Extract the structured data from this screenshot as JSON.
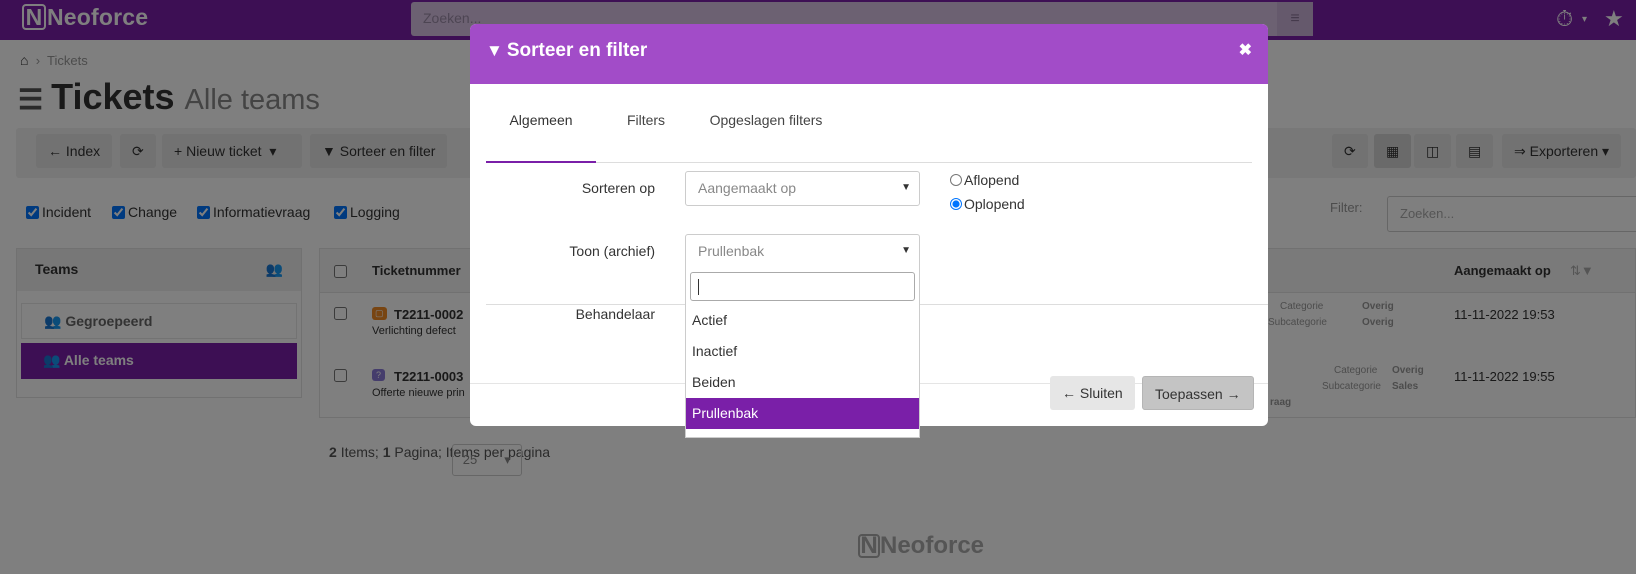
{
  "app": {
    "brand": "Neoforce",
    "search_placeholder": "Zoeken..."
  },
  "breadcrumb": {
    "current": "Tickets"
  },
  "page": {
    "title": "Tickets",
    "subtitle": "Alle teams"
  },
  "toolbar": {
    "index": "Index",
    "new_ticket": "Nieuw ticket",
    "sort_filter": "Sorteer en filter",
    "export": "Exporteren"
  },
  "types": [
    "Incident",
    "Change",
    "Informatievraag",
    "Logging"
  ],
  "filter": {
    "label": "Filter:",
    "placeholder": "Zoeken..."
  },
  "teams": {
    "header": "Teams",
    "items": [
      "Gegroepeerd",
      "Alle teams"
    ]
  },
  "grid": {
    "headers": {
      "number": "Ticketnummer",
      "created": "Aangemaakt op"
    },
    "rows": [
      {
        "number": "T2211-0002",
        "subject": "Verlichting defect",
        "category_label": "Categorie",
        "category": "Overig",
        "subcategory_label": "Subcategorie",
        "subcategory": "Overig",
        "created": "11-11-2022 19:53"
      },
      {
        "number": "T2211-0003",
        "subject": "Offerte nieuwe prin",
        "category_label": "Categorie",
        "category": "Overig",
        "subcategory_label": "Subcategorie",
        "subcategory": "Sales",
        "created": "11-11-2022 19:55",
        "extra": "raag"
      }
    ]
  },
  "pager": {
    "items": "2",
    "items_label": "Items;",
    "pages": "1",
    "pages_label": "Pagina;",
    "per_page": "25",
    "per_page_label": "Items per pagina"
  },
  "modal": {
    "title": "Sorteer en filter",
    "tabs": [
      "Algemeen",
      "Filters",
      "Opgeslagen filters"
    ],
    "sort_label": "Sorteren op",
    "sort_value": "Aangemaakt op",
    "order_desc": "Aflopend",
    "order_asc": "Oplopend",
    "archive_label": "Toon (archief)",
    "archive_value": "Prullenbak",
    "handler_label": "Behandelaar",
    "close_button": "Sluiten",
    "apply_button": "Toepassen",
    "dropdown_options": [
      "Actief",
      "Inactief",
      "Beiden",
      "Prullenbak"
    ]
  },
  "colors": {
    "brand": "#7a1fa8",
    "modal_header": "#a24cc8"
  }
}
